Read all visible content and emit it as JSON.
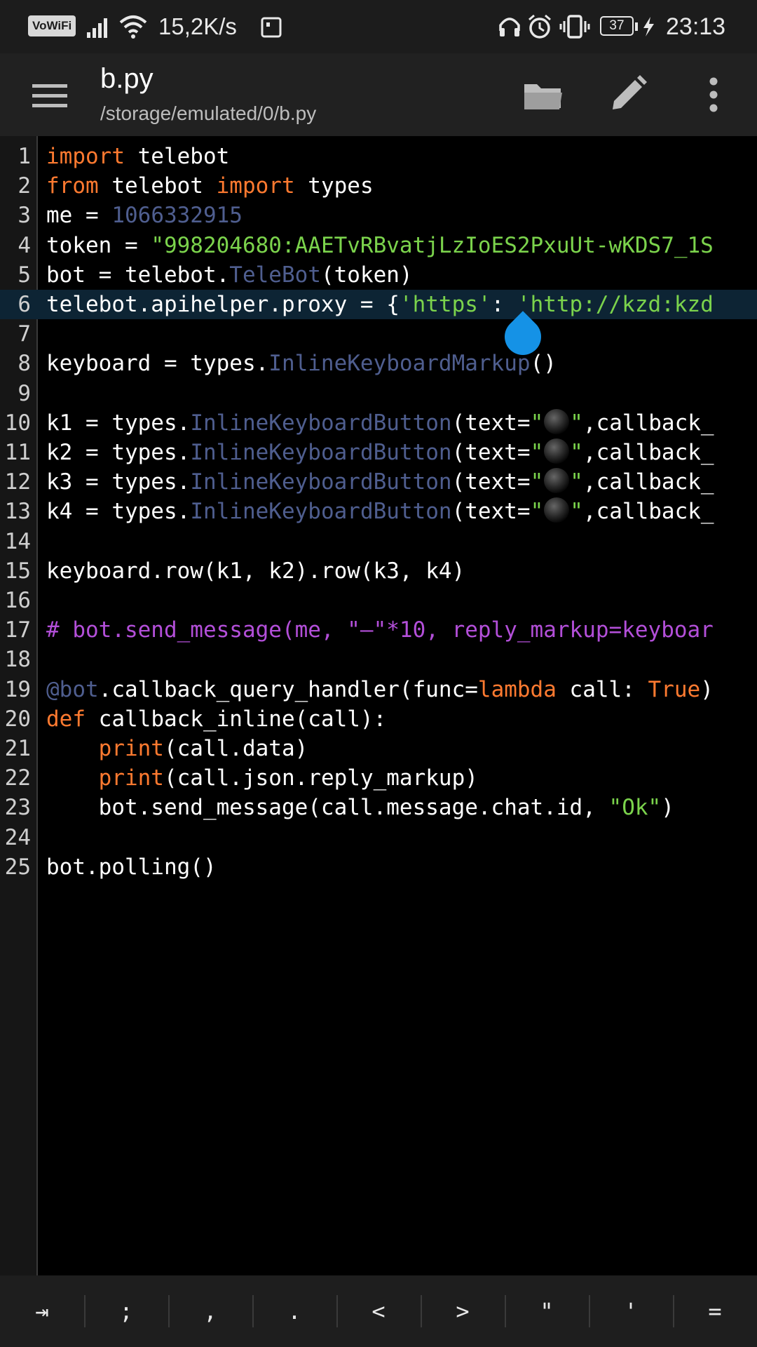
{
  "status_bar": {
    "vowifi": "VoWiFi",
    "network_speed": "15,2K/s",
    "battery": "37",
    "time": "23:13"
  },
  "app_bar": {
    "title": "b.py",
    "path": "/storage/emulated/0/b.py"
  },
  "editor": {
    "active_line": 6,
    "lines": [
      "import telebot",
      "from telebot import types",
      "me = 1066332915",
      "token = \"998204680:AAETvRBvatjLzIoES2PxuUt-wKDS7_1S",
      "bot = telebot.TeleBot(token)",
      "telebot.apihelper.proxy = {'https': 'http://kzd:kzd",
      "",
      "keyboard = types.InlineKeyboardMarkup()",
      "",
      "k1 = types.InlineKeyboardButton(text=\"⚫\",callback_",
      "k2 = types.InlineKeyboardButton(text=\"⚫\",callback_",
      "k3 = types.InlineKeyboardButton(text=\"⚫\",callback_",
      "k4 = types.InlineKeyboardButton(text=\"⚫\",callback_",
      "",
      "keyboard.row(k1, k2).row(k3, k4)",
      "",
      "# bot.send_message(me, \"—\"*10, reply_markup=keyboar",
      "",
      "@bot.callback_query_handler(func=lambda call: True)",
      "def callback_inline(call):",
      "    print(call.data)",
      "    print(call.json.reply_markup)",
      "    bot.send_message(call.message.chat.id, \"Ok\")",
      "",
      "bot.polling()"
    ]
  },
  "symbol_bar": {
    "keys": [
      "⇥",
      ";",
      ",",
      ".",
      "<",
      ">",
      "\"",
      "'",
      "="
    ]
  },
  "colors": {
    "keyword": "#ff7a30",
    "string": "#7bd34c",
    "class_and_number": "#4f5e8f",
    "comment": "#b34fd9",
    "active_line": "#0d2434",
    "cursor_handle": "#1592e6"
  }
}
